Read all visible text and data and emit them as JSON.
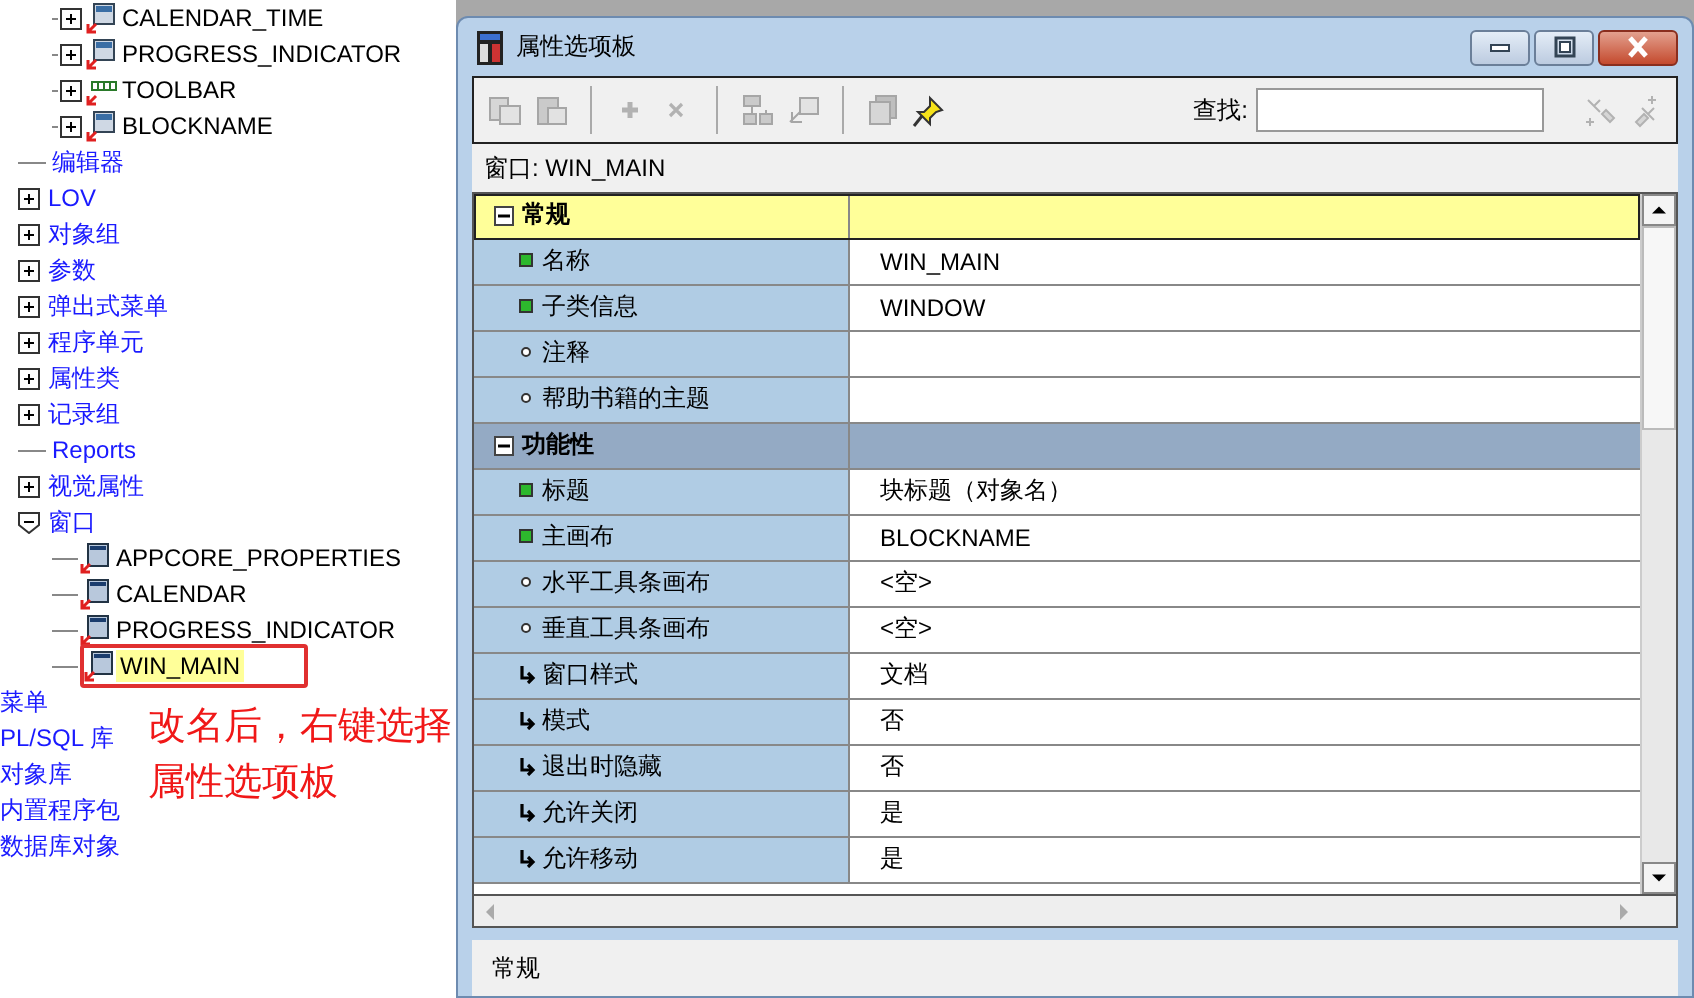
{
  "object_tree": {
    "upper_items": [
      {
        "label": "CALENDAR_TIME",
        "kind": "item"
      },
      {
        "label": "PROGRESS_INDICATOR",
        "kind": "item"
      },
      {
        "label": "TOOLBAR",
        "kind": "toolbar"
      },
      {
        "label": "BLOCKNAME",
        "kind": "item"
      }
    ],
    "nodes": [
      {
        "label": "编辑器",
        "kind": "leaf"
      },
      {
        "label": "LOV",
        "kind": "folder",
        "expanded": false
      },
      {
        "label": "对象组",
        "kind": "folder",
        "expanded": false
      },
      {
        "label": "参数",
        "kind": "folder",
        "expanded": false
      },
      {
        "label": "弹出式菜单",
        "kind": "folder",
        "expanded": false
      },
      {
        "label": "程序单元",
        "kind": "folder",
        "expanded": false
      },
      {
        "label": "属性类",
        "kind": "folder",
        "expanded": false
      },
      {
        "label": "记录组",
        "kind": "folder",
        "expanded": false
      },
      {
        "label": "Reports",
        "kind": "leaf"
      },
      {
        "label": "视觉属性",
        "kind": "folder",
        "expanded": false
      },
      {
        "label": "窗口",
        "kind": "folder",
        "expanded": true,
        "children": [
          {
            "label": "APPCORE_PROPERTIES",
            "selected": false,
            "annotated": false
          },
          {
            "label": "CALENDAR",
            "selected": false,
            "annotated": false
          },
          {
            "label": "PROGRESS_INDICATOR",
            "selected": false,
            "annotated": false
          },
          {
            "label": "WIN_MAIN",
            "selected": true,
            "annotated": true
          }
        ]
      }
    ],
    "outer_items": [
      {
        "label": "菜单"
      },
      {
        "label": "PL/SQL 库"
      },
      {
        "label": "对象库"
      },
      {
        "label": "内置程序包"
      },
      {
        "label": "数据库对象"
      }
    ]
  },
  "annotation": {
    "lines": [
      "改名后，右键选择",
      "属性选项板"
    ]
  },
  "window": {
    "title": "属性选项板",
    "toolbar": [
      {
        "kind": "copy",
        "disabled": true
      },
      {
        "kind": "paste",
        "disabled": true
      },
      {
        "kind": "sep"
      },
      {
        "kind": "add",
        "disabled": true
      },
      {
        "kind": "delete",
        "disabled": true
      },
      {
        "kind": "sep"
      },
      {
        "kind": "tree",
        "disabled": true
      },
      {
        "kind": "tree-arrow",
        "disabled": true
      },
      {
        "kind": "sep"
      },
      {
        "kind": "stack",
        "disabled": true
      },
      {
        "kind": "pin",
        "disabled": false
      }
    ],
    "search": {
      "label": "查找:"
    },
    "search_tools": [
      {
        "kind": "find-next",
        "disabled": true
      },
      {
        "kind": "find-prev",
        "disabled": true
      }
    ],
    "context_label": "窗口: WIN_MAIN",
    "properties": [
      {
        "kind": "category",
        "name": "常规",
        "selected": true
      },
      {
        "kind": "set",
        "name": "名称",
        "value": "WIN_MAIN"
      },
      {
        "kind": "set",
        "name": "子类信息",
        "value": "WINDOW"
      },
      {
        "kind": "default",
        "name": "注释"
      },
      {
        "kind": "default",
        "name": "帮助书籍的主题"
      },
      {
        "kind": "category",
        "name": "功能性",
        "selected": false
      },
      {
        "kind": "set",
        "name": "标题",
        "value": "块标题（对象名）"
      },
      {
        "kind": "set",
        "name": "主画布",
        "value": "BLOCKNAME"
      },
      {
        "kind": "default",
        "name": "水平工具条画布",
        "value": "<空>"
      },
      {
        "kind": "default",
        "name": "垂直工具条画布",
        "value": "<空>"
      },
      {
        "kind": "inherited",
        "name": "窗口样式",
        "value": "文档"
      },
      {
        "kind": "inherited",
        "name": "模式",
        "value": "否"
      },
      {
        "kind": "inherited",
        "name": "退出时隐藏",
        "value": "否"
      },
      {
        "kind": "inherited",
        "name": "允许关闭",
        "value": "是"
      },
      {
        "kind": "inherited",
        "name": "允许移动",
        "value": "是"
      }
    ],
    "status_bar": "常规"
  }
}
